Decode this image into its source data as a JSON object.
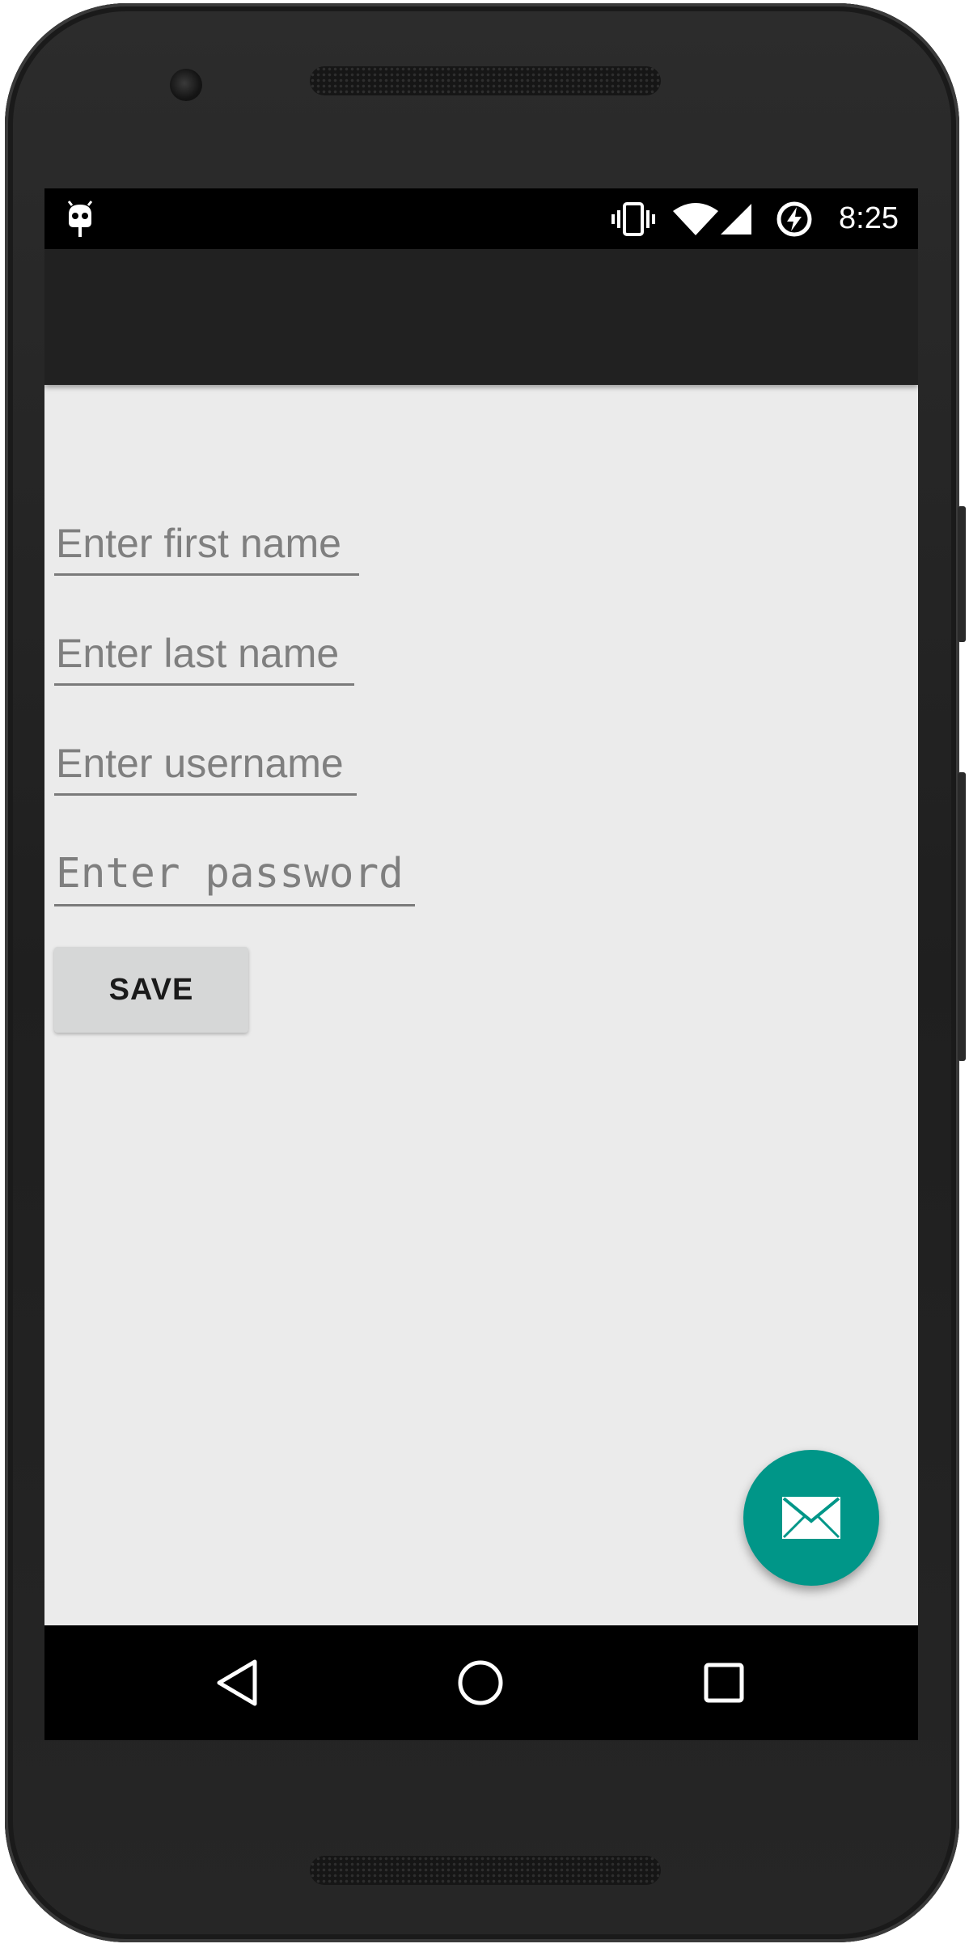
{
  "status_bar": {
    "time": "8:25",
    "icons": [
      "cyanogenmod-bugdroid-icon",
      "vibrate-icon",
      "wifi-icon",
      "cell-signal-icon",
      "battery-charging-icon"
    ]
  },
  "form": {
    "first_name": {
      "placeholder": "Enter first name"
    },
    "last_name": {
      "placeholder": "Enter last name"
    },
    "username": {
      "placeholder": "Enter username"
    },
    "password": {
      "placeholder": "Enter password"
    },
    "save_label": "SAVE"
  },
  "fab": {
    "icon": "email-icon",
    "color": "#009688"
  },
  "nav_bar": {
    "buttons": [
      "back-icon",
      "home-icon",
      "recents-icon"
    ]
  },
  "colors": {
    "app_bar": "#212121",
    "screen_background": "#ebebeb",
    "accent": "#009688"
  }
}
